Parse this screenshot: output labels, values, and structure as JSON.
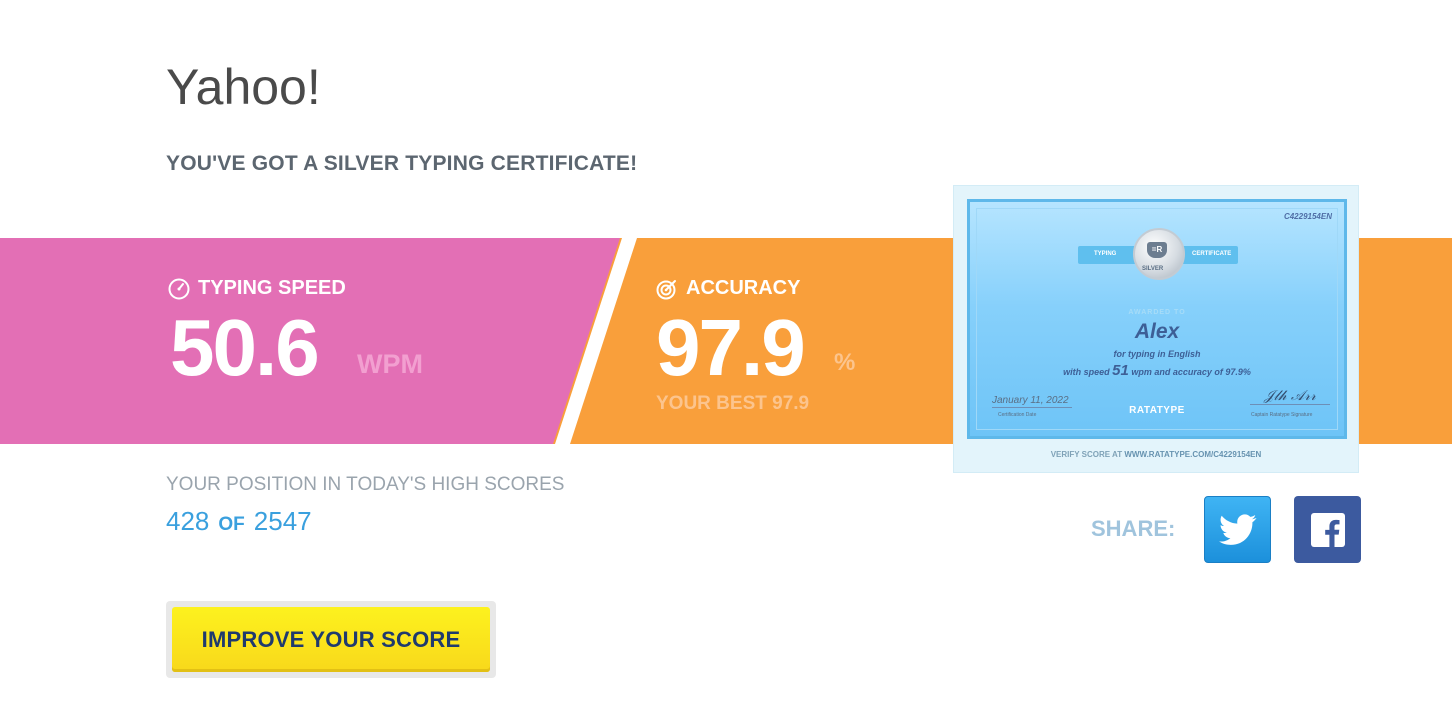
{
  "title": "Yahoo!",
  "subtitle": "YOU'VE GOT A SILVER TYPING CERTIFICATE!",
  "speed": {
    "label": "TYPING SPEED",
    "value": "50.6",
    "unit": "WPM",
    "icon": "speedometer-icon"
  },
  "accuracy": {
    "label": "ACCURACY",
    "value": "97.9",
    "unit": "%",
    "best": "YOUR BEST 97.9",
    "icon": "target-icon"
  },
  "certificate": {
    "id": "C4229154EN",
    "ribbon_left": "TYPING",
    "ribbon_right": "CERTIFICATE",
    "seal_mark": "=R",
    "level": "SILVER",
    "awarded_to": "AWARDED TO",
    "name": "Alex",
    "line1": "for typing in English",
    "line2_pre": "with speed",
    "line2_speed": "51",
    "line2_post": "wpm and accuracy of 97.9%",
    "date": "January 11, 2022",
    "date_caption": "Certification Date",
    "logo": "RATATYPE",
    "signature_caption": "Captain Ratatype Signature",
    "verify_prefix": "VERIFY SCORE AT",
    "verify_url": "WWW.RATATYPE.COM",
    "verify_suffix": "/C4229154EN"
  },
  "highscores": {
    "label": "YOUR POSITION IN TODAY'S HIGH SCORES",
    "position": "428",
    "of": "OF",
    "total": "2547"
  },
  "share": {
    "label": "SHARE:",
    "buttons": [
      "twitter-icon",
      "facebook-icon"
    ]
  },
  "improve_button": "IMPROVE YOUR SCORE",
  "colors": {
    "pink": "#e36fb5",
    "orange": "#f99f3b",
    "blue": "#3aa0de",
    "yellow": "#fde61d"
  }
}
